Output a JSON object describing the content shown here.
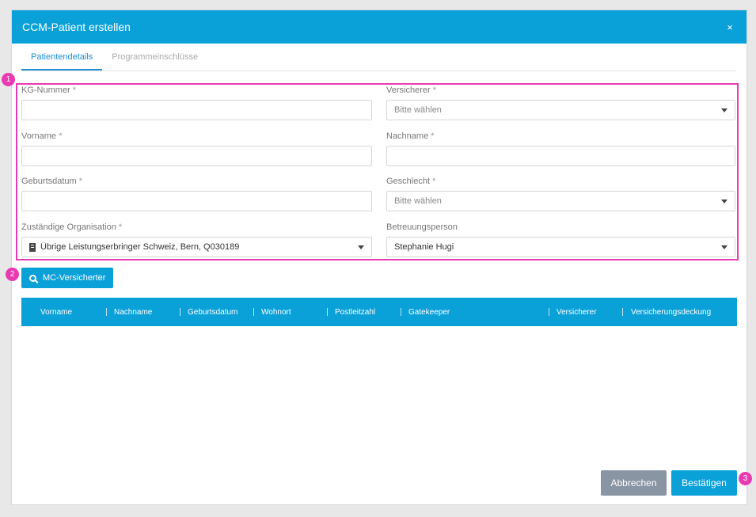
{
  "dialog": {
    "title": "CCM-Patient erstellen",
    "close_label": "×"
  },
  "tabs": [
    {
      "label": "Patientendetails"
    },
    {
      "label": "Programmeinschlüsse"
    }
  ],
  "badges": [
    "1",
    "2",
    "3"
  ],
  "form": {
    "required_mark": "*",
    "kg_nummer": {
      "label": "KG-Nummer",
      "value": ""
    },
    "versicherer": {
      "label": "Versicherer",
      "placeholder": "Bitte wählen"
    },
    "vorname": {
      "label": "Vorname",
      "value": ""
    },
    "nachname": {
      "label": "Nachname",
      "value": ""
    },
    "geburtsdatum": {
      "label": "Geburtsdatum",
      "value": ""
    },
    "geschlecht": {
      "label": "Geschlecht",
      "placeholder": "Bitte wählen"
    },
    "organisation": {
      "label": "Zuständige Organisation",
      "value": "Übrige Leistungserbringer Schweiz, Bern, Q030189",
      "icon": "building-icon"
    },
    "betreuungsperson": {
      "label": "Betreuungsperson",
      "value": "Stephanie Hugi"
    }
  },
  "mc_button": {
    "label": "MC-Versicherter",
    "icon": "search-icon"
  },
  "table": {
    "columns": [
      "Vorname",
      "Nachname",
      "Geburtsdatum",
      "Wohnort",
      "Postleitzahl",
      "Gatekeeper",
      "Versicherer",
      "Versicherungsdeckung"
    ]
  },
  "footer": {
    "cancel_label": "Abbrechen",
    "confirm_label": "Bestätigen"
  },
  "colors": {
    "primary": "#0aa0d8",
    "highlight": "#e93bb1",
    "cancel": "#8a95a3"
  }
}
